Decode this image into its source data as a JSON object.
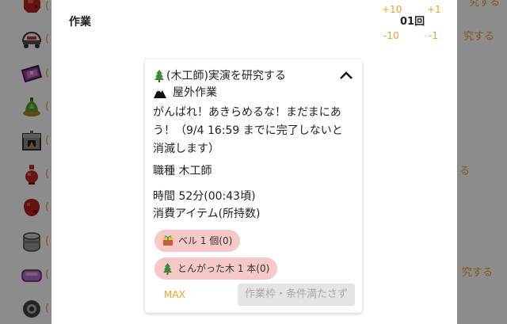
{
  "colors": {
    "accent": "#f0a030",
    "pill_bg": "#f7c8c8",
    "button_bg": "#e4e4e4",
    "button_text": "#aaaaaa"
  },
  "background": {
    "sidebar": [
      {
        "icon": "meat-icon",
        "text": "("
      },
      {
        "icon": "helmet-icon",
        "text": "("
      },
      {
        "icon": "rug-icon",
        "text": "("
      },
      {
        "icon": "potted-plant-icon",
        "text": "("
      },
      {
        "icon": "furnace-icon",
        "text": "("
      },
      {
        "icon": "potion-icon",
        "text": "("
      },
      {
        "icon": "red-orb-icon",
        "text": "("
      },
      {
        "icon": "bucket-icon",
        "text": "("
      },
      {
        "icon": "cushion-icon",
        "text": "("
      },
      {
        "icon": "tire-icon",
        "text": "("
      }
    ],
    "right_texts": [
      "究する",
      "究する",
      "る",
      "究する"
    ]
  },
  "modal": {
    "title": "作業",
    "counter": {
      "plus10": "+10",
      "plus1": "+1",
      "value": "01回",
      "minus10": "-10",
      "minus1": "-1"
    },
    "task": {
      "title_icon": "tree-icon",
      "title": "(木工師)実演を研究する",
      "collapse_icon": "chevron-up-icon",
      "location_icon": "mountain-icon",
      "location": "屋外作業",
      "message": "がんばれ！あきらめるな！まだまにあう！（9/4 16:59 までに完了しないと消滅します）",
      "job": "職種 木工師",
      "time": "時間 52分(00:43頃)",
      "items_label": "消費アイテム(所持数)",
      "items": [
        {
          "icon": "gift-icon",
          "label": "ベル 1 個(0)"
        },
        {
          "icon": "tree-icon",
          "label": "とんがった木 1 本(0)"
        }
      ],
      "max_label": "MAX",
      "submit_label": "作業枠・条件満たさず"
    }
  }
}
